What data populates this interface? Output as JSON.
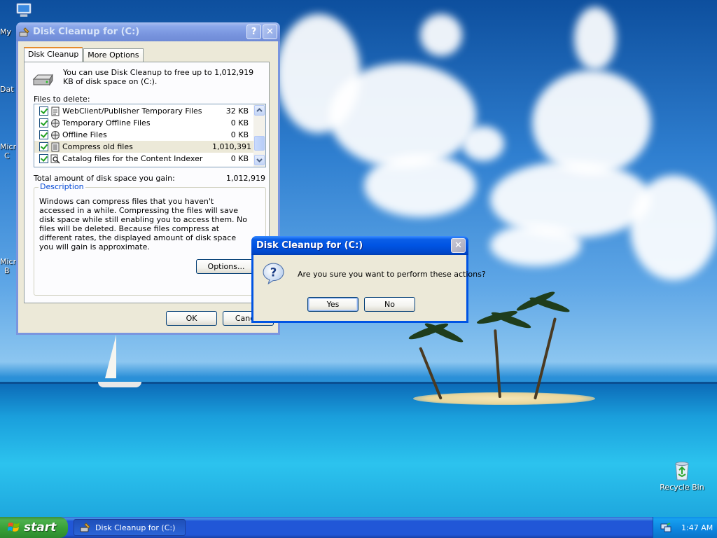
{
  "desktop": {
    "icons": {
      "my_computer_short": "My",
      "data_short": "Dat",
      "micro_short_1": "Micro",
      "micro_short_1b": "C",
      "micro_short_2": "Micro",
      "micro_short_2b": "B",
      "recycle_bin": "Recycle Bin"
    }
  },
  "main_window": {
    "title": "Disk Cleanup for  (C:)",
    "help_btn": "?",
    "close_btn": "✕",
    "tabs": [
      "Disk Cleanup",
      "More Options"
    ],
    "intro_text": "You can use Disk Cleanup to free up to 1,012,919 KB of disk space on  (C:).",
    "files_label": "Files to delete:",
    "files": [
      {
        "label": "WebClient/Publisher Temporary Files",
        "size": "32 KB",
        "checked": true,
        "icon": "page-icon"
      },
      {
        "label": "Temporary Offline Files",
        "size": "0 KB",
        "checked": true,
        "icon": "offline-files-icon"
      },
      {
        "label": "Offline Files",
        "size": "0 KB",
        "checked": true,
        "icon": "offline-files-icon"
      },
      {
        "label": "Compress old files",
        "size": "1,010,391",
        "checked": true,
        "icon": "compress-icon"
      },
      {
        "label": "Catalog files for the Content Indexer",
        "size": "0 KB",
        "checked": true,
        "icon": "search-doc-icon"
      }
    ],
    "total_label": "Total amount of disk space you gain:",
    "total_value": "1,012,919",
    "description_label": "Description",
    "description_text": "Windows can compress files that you haven't accessed in a while. Compressing the files will save disk space while still enabling you to access them. No files will be deleted. Because files compress at different rates, the displayed amount of disk space you will gain is approximate.",
    "options_btn": "Options...",
    "ok_btn": "OK",
    "cancel_btn": "Cancel"
  },
  "confirm_dialog": {
    "title": "Disk Cleanup for  (C:)",
    "close_btn": "✕",
    "message": "Are you sure you want to perform these actions?",
    "yes_btn": "Yes",
    "no_btn": "No"
  },
  "taskbar": {
    "start_label": "start",
    "task_label": "Disk Cleanup for  (C:)",
    "clock": "1:47 AM"
  },
  "colors": {
    "title_active": "#0054e3",
    "title_inactive": "#7a96df",
    "dialog_face": "#ece9d8",
    "start_green": "#37a037",
    "taskbar_blue": "#2157d7"
  }
}
